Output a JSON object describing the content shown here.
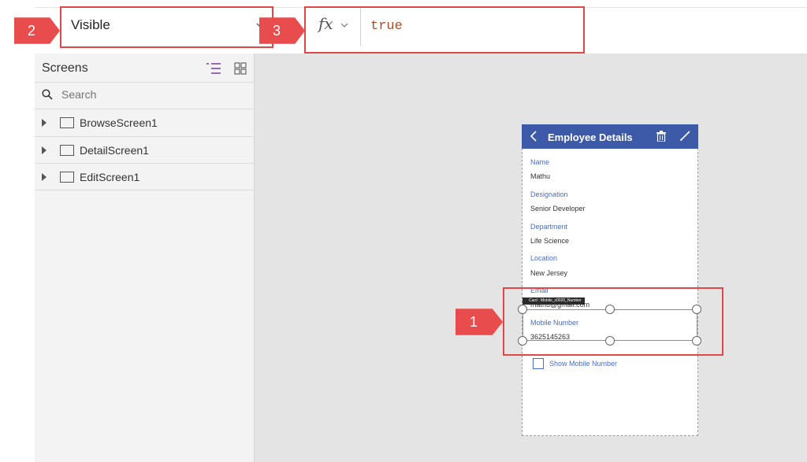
{
  "property_selector": {
    "value": "Visible"
  },
  "formula_bar": {
    "fx_label": "fx",
    "formula": "true"
  },
  "screens_panel": {
    "title": "Screens",
    "search_placeholder": "Search",
    "items": [
      {
        "label": "BrowseScreen1"
      },
      {
        "label": "DetailScreen1"
      },
      {
        "label": "EditScreen1"
      }
    ]
  },
  "phone": {
    "header_title": "Employee Details",
    "fields": [
      {
        "label": "Name",
        "value": "Mathu"
      },
      {
        "label": "Designation",
        "value": "Senior Developer"
      },
      {
        "label": "Department",
        "value": "Life Science"
      },
      {
        "label": "Location",
        "value": "New Jersey"
      },
      {
        "label": "Email",
        "value": "mathu@gmail.com"
      },
      {
        "label": "Mobile Number",
        "value": "3625145263"
      }
    ],
    "card_tag": "Card : Mobile_x0020_Number",
    "checkbox_label": "Show Mobile Number"
  },
  "callouts": {
    "one": "1",
    "two": "2",
    "three": "3"
  },
  "colors": {
    "callout_red": "#e84c4c",
    "header_blue": "#3c5aa8",
    "field_label_blue": "#4a6cc0"
  }
}
